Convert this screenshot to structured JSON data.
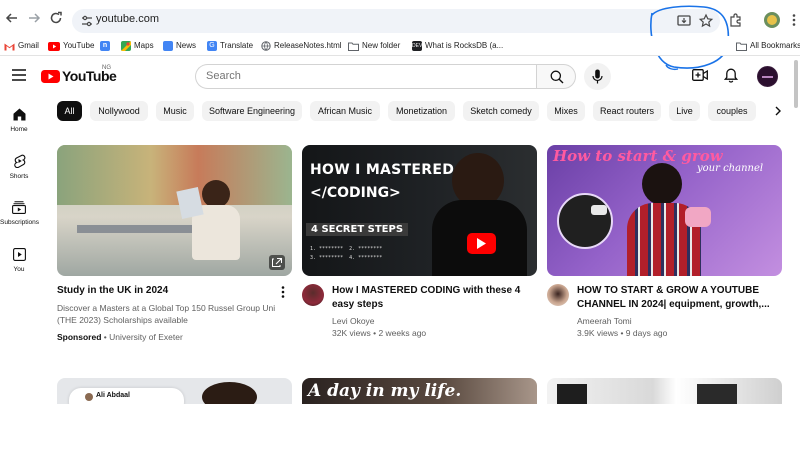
{
  "browser": {
    "url": "youtube.com",
    "bookmarks": [
      {
        "label": "Gmail",
        "color": "#ea4335"
      },
      {
        "label": "YouTube",
        "color": "#ff0000"
      },
      {
        "label": "",
        "color": "#4285f4"
      },
      {
        "label": "Maps",
        "color": "#34a853"
      },
      {
        "label": "News",
        "color": "#4285f4"
      },
      {
        "label": "Translate",
        "color": "#4285f4"
      },
      {
        "label": "ReleaseNotes.html",
        "color": "#5f6368"
      },
      {
        "label": "New folder",
        "color": "#5f6368"
      },
      {
        "label": "What is RocksDB (a...",
        "color": "#202124"
      }
    ],
    "all_bookmarks": "All Bookmarks"
  },
  "header": {
    "logo_text": "YouTube",
    "region": "NG",
    "search_placeholder": "Search"
  },
  "sidebar": [
    {
      "label": "Home",
      "icon": "home-icon"
    },
    {
      "label": "Shorts",
      "icon": "shorts-icon"
    },
    {
      "label": "Subscriptions",
      "icon": "subscriptions-icon"
    },
    {
      "label": "You",
      "icon": "you-icon"
    }
  ],
  "chips": [
    "All",
    "Nollywood",
    "Music",
    "Software Engineering",
    "African Music",
    "Monetization",
    "Sketch comedy",
    "Mixes",
    "React routers",
    "Live",
    "couples"
  ],
  "videos": [
    {
      "title": "Study in the UK in 2024",
      "desc": "Discover a Masters at a Global Top 150 Russel Group Uni (THE 2023) Scholarships available",
      "sponsored": "Sponsored",
      "advertiser": "University of Exeter"
    },
    {
      "title": "How I MASTERED CODING with these 4 easy steps",
      "channel": "Levi Okoye",
      "stats": "32K views • 2 weeks ago",
      "thumb_line1": "HOW I MASTERED",
      "thumb_line2": "</CODING>",
      "thumb_line3": "4 SECRET STEPS"
    },
    {
      "title": "HOW TO START & GROW A YOUTUBE CHANNEL IN 2024| equipment, growth,...",
      "channel": "Ameerah Tomi",
      "stats": "3.9K views • 9 days ago",
      "thumb_text": "How to start & grow",
      "thumb_sub": "your channel"
    }
  ],
  "row2": {
    "thumb2_text": "A day in my life.",
    "thumb1_name": "Ali Abdaal"
  },
  "colors": {
    "brand_red": "#ff0000",
    "annotation": "#1a73e8"
  }
}
